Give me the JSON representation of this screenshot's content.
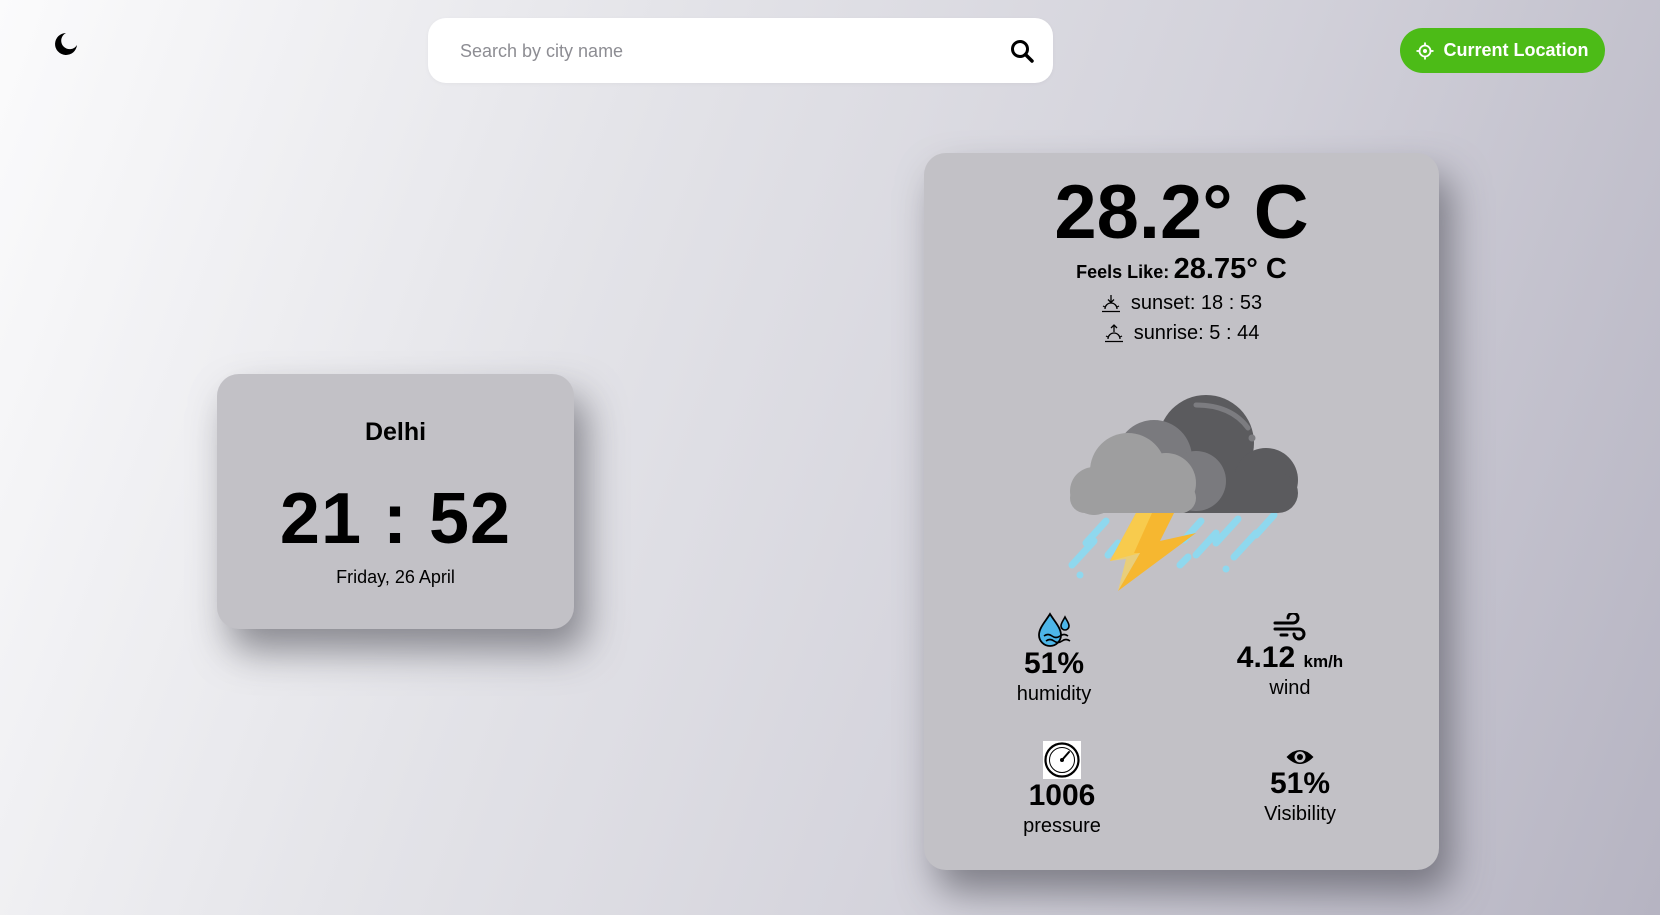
{
  "header": {
    "search_placeholder": "Search by city name",
    "current_location_label": "Current Location",
    "accent_color": "#4cbb17"
  },
  "clock_card": {
    "city": "Delhi",
    "time": "21 : 52",
    "date": "Friday, 26 April"
  },
  "weather_card": {
    "temperature": "28.2° C",
    "feels_like_label": "Feels Like:",
    "feels_like_value": "28.75° C",
    "sunset": "sunset: 18 : 53",
    "sunrise": "sunrise: 5 : 44",
    "condition_icon": "thunderstorm-icon",
    "stats": {
      "humidity": {
        "value": "51%",
        "label": "humidity",
        "icon": "humidity-icon"
      },
      "wind": {
        "value": "4.12",
        "unit": "km/h",
        "label": "wind",
        "icon": "wind-icon"
      },
      "pressure": {
        "value": "1006",
        "label": "pressure",
        "icon": "gauge-icon"
      },
      "visibility": {
        "value": "51%",
        "label": "Visibility",
        "icon": "eye-icon"
      }
    }
  }
}
